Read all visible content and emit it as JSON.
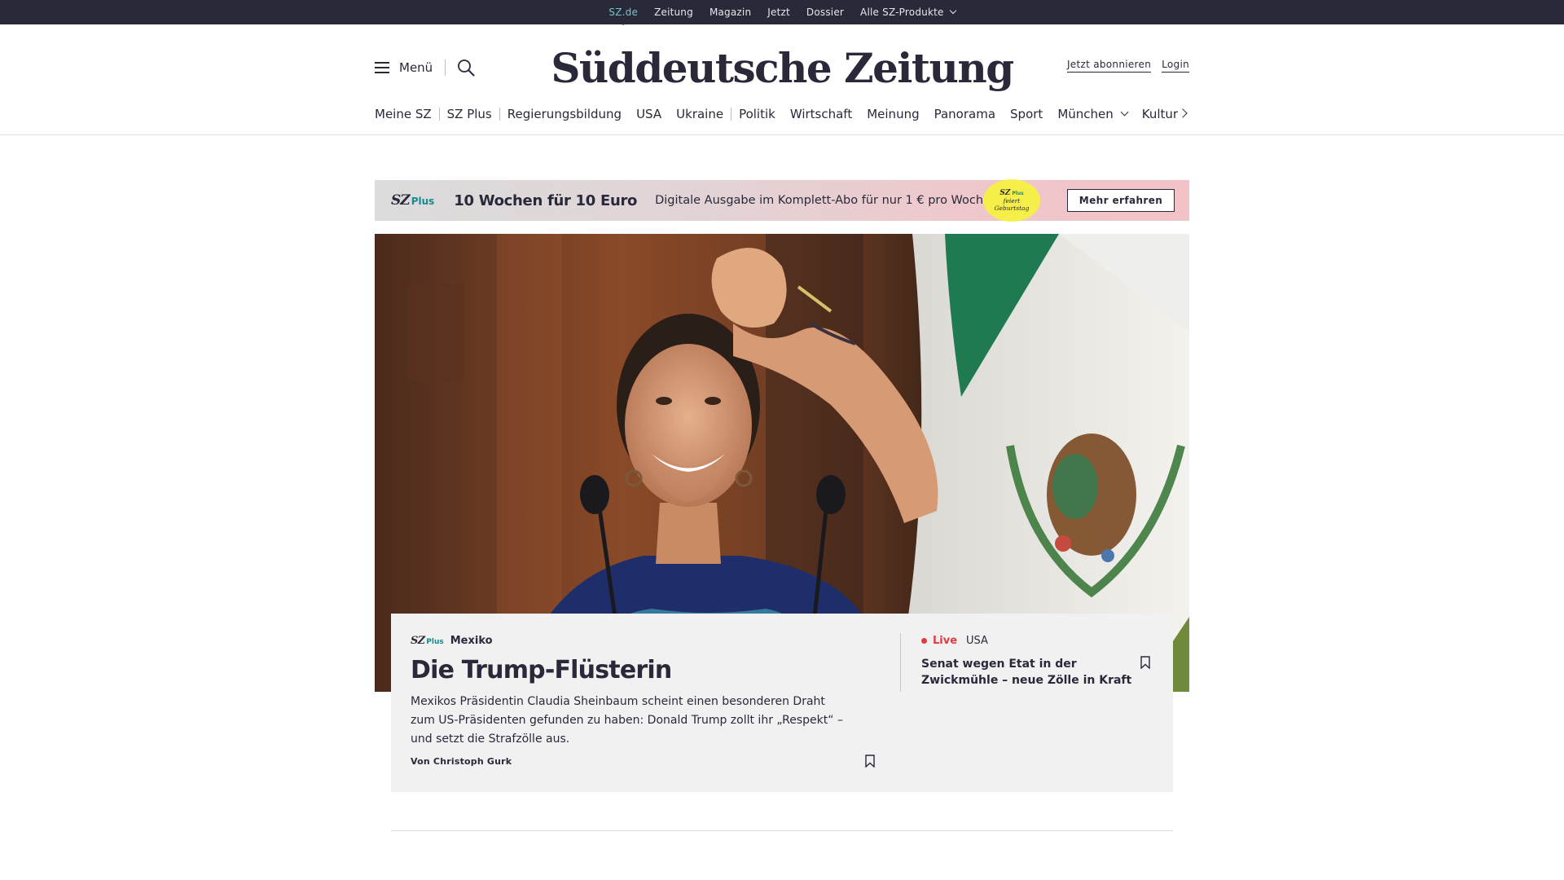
{
  "topbar": {
    "links": [
      "SZ.de",
      "Zeitung",
      "Magazin",
      "Jetzt",
      "Dossier",
      "Alle SZ-Produkte"
    ]
  },
  "header": {
    "menu_label": "Menü",
    "logo_text": "Süddeutsche Zeitung",
    "subscribe_label": "Jetzt abonnieren",
    "login_label": "Login"
  },
  "nav": {
    "items": [
      "Meine SZ",
      "SZ Plus",
      "Regierungsbildung",
      "USA",
      "Ukraine",
      "Politik",
      "Wirtschaft",
      "Meinung",
      "Panorama",
      "Sport",
      "München",
      "Kultur"
    ]
  },
  "promo": {
    "brand": "SZ",
    "brand_plus": "Plus",
    "headline": "10 Wochen für 10 Euro",
    "description": "Digitale Ausgabe im Komplett-Abo für nur 1 € pro Woche.",
    "badge_brand": "SZ",
    "badge_plus": "Plus",
    "badge_line1": "feiert",
    "badge_line2": "Geburtstag",
    "cta_label": "Mehr erfahren"
  },
  "teaser": {
    "brand": "SZ",
    "brand_plus": "Plus",
    "kicker": "Mexiko",
    "title": "Die Trump-Flüsterin",
    "text": "Mexikos Präsidentin Claudia Sheinbaum scheint einen besonderen Draht zum US-Präsidenten gefunden zu haben: Donald Trump zollt ihr  „Respekt“ – und setzt die Strafzölle aus.",
    "author": "Von Christoph Gurk"
  },
  "live": {
    "label": "Live",
    "category": "USA",
    "title": "Senat wegen Etat in der Zwickmühle – neue Zölle in Kraft"
  },
  "colors": {
    "ink": "#29293a",
    "accent_teal": "#71c7c8",
    "plus_teal": "#168a8c",
    "live_red": "#e3393f",
    "badge_yellow": "#f7ef49"
  }
}
